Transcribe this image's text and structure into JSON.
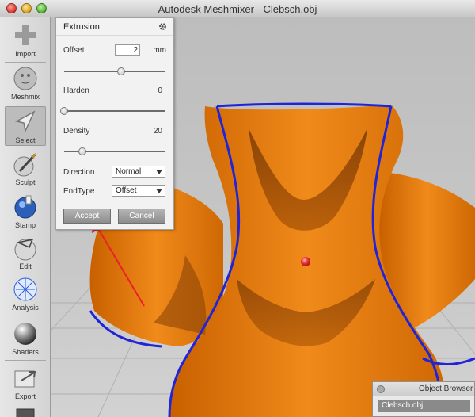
{
  "window": {
    "title": "Autodesk Meshmixer - Clebsch.obj"
  },
  "toolbar": {
    "tools": [
      {
        "label": "Import",
        "icon": "import-plus-icon"
      },
      {
        "label": "Meshmix",
        "icon": "meshmix-ball-icon"
      },
      {
        "label": "Select",
        "icon": "select-arrow-icon"
      },
      {
        "label": "Sculpt",
        "icon": "sculpt-brush-icon"
      },
      {
        "label": "Stamp",
        "icon": "stamp-ball-icon"
      },
      {
        "label": "Edit",
        "icon": "edit-ball-icon"
      },
      {
        "label": "Analysis",
        "icon": "analysis-ball-icon"
      },
      {
        "label": "Shaders",
        "icon": "shaders-ball-icon"
      },
      {
        "label": "Export",
        "icon": "export-icon"
      }
    ]
  },
  "extrusion_panel": {
    "title": "Extrusion",
    "offset": {
      "label": "Offset",
      "value": "2",
      "unit": "mm",
      "slider_fraction": 0.56
    },
    "harden": {
      "label": "Harden",
      "value": "0",
      "slider_fraction": 0.0
    },
    "density": {
      "label": "Density",
      "value": "20",
      "slider_fraction": 0.18
    },
    "direction": {
      "label": "Direction",
      "selected": "Normal"
    },
    "endtype": {
      "label": "EndType",
      "selected": "Offset"
    },
    "accept_label": "Accept",
    "cancel_label": "Cancel"
  },
  "object_browser": {
    "title": "Object Browser",
    "items": [
      "Clebsch.obj"
    ]
  },
  "colors": {
    "mesh_orange": "#e07a0e",
    "boundary_blue": "#1f24d6",
    "annotation_red": "#e8202a"
  }
}
